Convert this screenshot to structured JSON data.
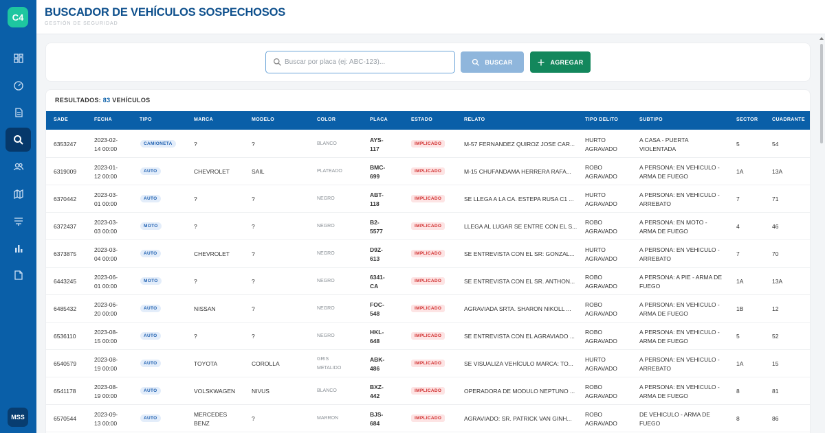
{
  "app": {
    "logo": "C4",
    "user_initials": "MSS"
  },
  "header": {
    "title": "BUSCADOR DE VEHÍCULOS SOSPECHOSOS",
    "subtitle": "GESTIÓN DE SEGURIDAD"
  },
  "sidebar": {
    "items": [
      "dashboard-icon",
      "speedometer-icon",
      "document-icon",
      "search-icon",
      "users-icon",
      "map-icon",
      "layers-icon",
      "bar-chart-icon",
      "file-icon"
    ],
    "active_index": 3
  },
  "search": {
    "placeholder": "Buscar por placa (ej: ABC-123)...",
    "value": "",
    "search_label": "BUSCAR",
    "add_label": "AGREGAR"
  },
  "colors": {
    "primary": "#0a5fa8",
    "accent_green": "#13875c",
    "search_button": "#8fb6dc",
    "estado_red": "#d02d2d"
  },
  "results": {
    "label": "RESULTADOS:",
    "count": "83",
    "unit": "VEHÍCULOS",
    "columns": [
      "SADE",
      "FECHA",
      "TIPO",
      "MARCA",
      "MODELO",
      "COLOR",
      "PLACA",
      "ESTADO",
      "RELATO",
      "TIPO DELITO",
      "SUBTIPO",
      "SECTOR",
      "CUADRANTE"
    ],
    "rows": [
      {
        "sade": "6353247",
        "fecha1": "2023-02-",
        "fecha2": "14 00:00",
        "tipo": "CAMIONETA",
        "marca": "?",
        "marca2": "",
        "modelo": "?",
        "color": "BLANCO",
        "color2": "",
        "placa1": "AYS-",
        "placa2": "117",
        "estado": "IMPLICADO",
        "relato": "M-57 FERNANDEZ QUIROZ JOSE CAR...",
        "delito1": "HURTO",
        "delito2": "AGRAVADO",
        "sub1": "A CASA - PUERTA",
        "sub2": "VIOLENTADA",
        "sector": "5",
        "cuadrante": "54"
      },
      {
        "sade": "6319009",
        "fecha1": "2023-01-",
        "fecha2": "12 00:00",
        "tipo": "AUTO",
        "marca": "CHEVROLET",
        "marca2": "",
        "modelo": "SAIL",
        "color": "PLATEADO",
        "color2": "",
        "placa1": "BMC-",
        "placa2": "699",
        "estado": "IMPLICADO",
        "relato": "M-15 CHUFANDAMA HERRERA RAFA...",
        "delito1": "ROBO",
        "delito2": "AGRAVADO",
        "sub1": "A PERSONA: EN VEHICULO -",
        "sub2": "ARMA DE FUEGO",
        "sector": "1A",
        "cuadrante": "13A"
      },
      {
        "sade": "6370442",
        "fecha1": "2023-03-",
        "fecha2": "01 00:00",
        "tipo": "AUTO",
        "marca": "?",
        "marca2": "",
        "modelo": "?",
        "color": "NEGRO",
        "color2": "",
        "placa1": "ABT-",
        "placa2": "118",
        "estado": "IMPLICADO",
        "relato": "SE LLEGA A LA CA. ESTEPA RUSA C1 ...",
        "delito1": "HURTO",
        "delito2": "AGRAVADO",
        "sub1": "A PERSONA: EN VEHICULO -",
        "sub2": "ARREBATO",
        "sector": "7",
        "cuadrante": "71"
      },
      {
        "sade": "6372437",
        "fecha1": "2023-03-",
        "fecha2": "03 00:00",
        "tipo": "MOTO",
        "marca": "?",
        "marca2": "",
        "modelo": "?",
        "color": "NEGRO",
        "color2": "",
        "placa1": "B2-",
        "placa2": "5577",
        "estado": "IMPLICADO",
        "relato": "LLEGA AL LUGAR SE ENTRE CON EL S...",
        "delito1": "ROBO",
        "delito2": "AGRAVADO",
        "sub1": "A PERSONA: EN MOTO -",
        "sub2": "ARMA DE FUEGO",
        "sector": "4",
        "cuadrante": "46"
      },
      {
        "sade": "6373875",
        "fecha1": "2023-03-",
        "fecha2": "04 00:00",
        "tipo": "AUTO",
        "marca": "CHEVROLET",
        "marca2": "",
        "modelo": "?",
        "color": "NEGRO",
        "color2": "",
        "placa1": "D9Z-",
        "placa2": "613",
        "estado": "IMPLICADO",
        "relato": "SE ENTREVISTA CON EL SR: GONZAL...",
        "delito1": "HURTO",
        "delito2": "AGRAVADO",
        "sub1": "A PERSONA: EN VEHICULO -",
        "sub2": "ARREBATO",
        "sector": "7",
        "cuadrante": "70"
      },
      {
        "sade": "6443245",
        "fecha1": "2023-06-",
        "fecha2": "01 00:00",
        "tipo": "MOTO",
        "marca": "?",
        "marca2": "",
        "modelo": "?",
        "color": "NEGRO",
        "color2": "",
        "placa1": "6341-",
        "placa2": "CA",
        "estado": "IMPLICADO",
        "relato": "SE ENTREVISTA CON EL SR. ANTHON...",
        "delito1": "ROBO",
        "delito2": "AGRAVADO",
        "sub1": "A PERSONA: A PIE - ARMA DE",
        "sub2": "FUEGO",
        "sector": "1A",
        "cuadrante": "13A"
      },
      {
        "sade": "6485432",
        "fecha1": "2023-06-",
        "fecha2": "20 00:00",
        "tipo": "AUTO",
        "marca": "NISSAN",
        "marca2": "",
        "modelo": "?",
        "color": "NEGRO",
        "color2": "",
        "placa1": "FOC-",
        "placa2": "548",
        "estado": "IMPLICADO",
        "relato": "AGRAVIADA SRTA. SHARON NIKOLL ...",
        "delito1": "ROBO",
        "delito2": "AGRAVADO",
        "sub1": "A PERSONA: EN VEHICULO -",
        "sub2": "ARMA DE FUEGO",
        "sector": "1B",
        "cuadrante": "12"
      },
      {
        "sade": "6536110",
        "fecha1": "2023-08-",
        "fecha2": "15 00:00",
        "tipo": "AUTO",
        "marca": "?",
        "marca2": "",
        "modelo": "?",
        "color": "NEGRO",
        "color2": "",
        "placa1": "HKL-",
        "placa2": "648",
        "estado": "IMPLICADO",
        "relato": "SE ENTREVISTA CON EL AGRAVIADO ...",
        "delito1": "ROBO",
        "delito2": "AGRAVADO",
        "sub1": "A PERSONA: EN VEHICULO -",
        "sub2": "ARMA DE FUEGO",
        "sector": "5",
        "cuadrante": "52"
      },
      {
        "sade": "6540579",
        "fecha1": "2023-08-",
        "fecha2": "19 00:00",
        "tipo": "AUTO",
        "marca": "TOYOTA",
        "marca2": "",
        "modelo": "COROLLA",
        "color": "GRIS",
        "color2": "METALIDO",
        "placa1": "ABK-",
        "placa2": "486",
        "estado": "IMPLICADO",
        "relato": "SE VISUALIZA VEHÍCULO MARCA: TO...",
        "delito1": "HURTO",
        "delito2": "AGRAVADO",
        "sub1": "A PERSONA: EN VEHICULO -",
        "sub2": "ARREBATO",
        "sector": "1A",
        "cuadrante": "15"
      },
      {
        "sade": "6541178",
        "fecha1": "2023-08-",
        "fecha2": "19 00:00",
        "tipo": "AUTO",
        "marca": "VOLSKWAGEN",
        "marca2": "",
        "modelo": "NIVUS",
        "color": "BLANCO",
        "color2": "",
        "placa1": "BXZ-",
        "placa2": "442",
        "estado": "IMPLICADO",
        "relato": "OPERADORA DE MODULO NEPTUNO ...",
        "delito1": "ROBO",
        "delito2": "AGRAVADO",
        "sub1": "A PERSONA: EN VEHICULO -",
        "sub2": "ARMA DE FUEGO",
        "sector": "8",
        "cuadrante": "81"
      },
      {
        "sade": "6570544",
        "fecha1": "2023-09-",
        "fecha2": "13 00:00",
        "tipo": "AUTO",
        "marca": "MERCEDES",
        "marca2": "BENZ",
        "modelo": "?",
        "color": "MARRON",
        "color2": "",
        "placa1": "BJS-",
        "placa2": "684",
        "estado": "IMPLICADO",
        "relato": "AGRAVIADO: SR. PATRICK VAN GINH...",
        "delito1": "ROBO",
        "delito2": "AGRAVADO",
        "sub1": "DE VEHICULO - ARMA DE",
        "sub2": "FUEGO",
        "sector": "8",
        "cuadrante": "86"
      }
    ]
  }
}
